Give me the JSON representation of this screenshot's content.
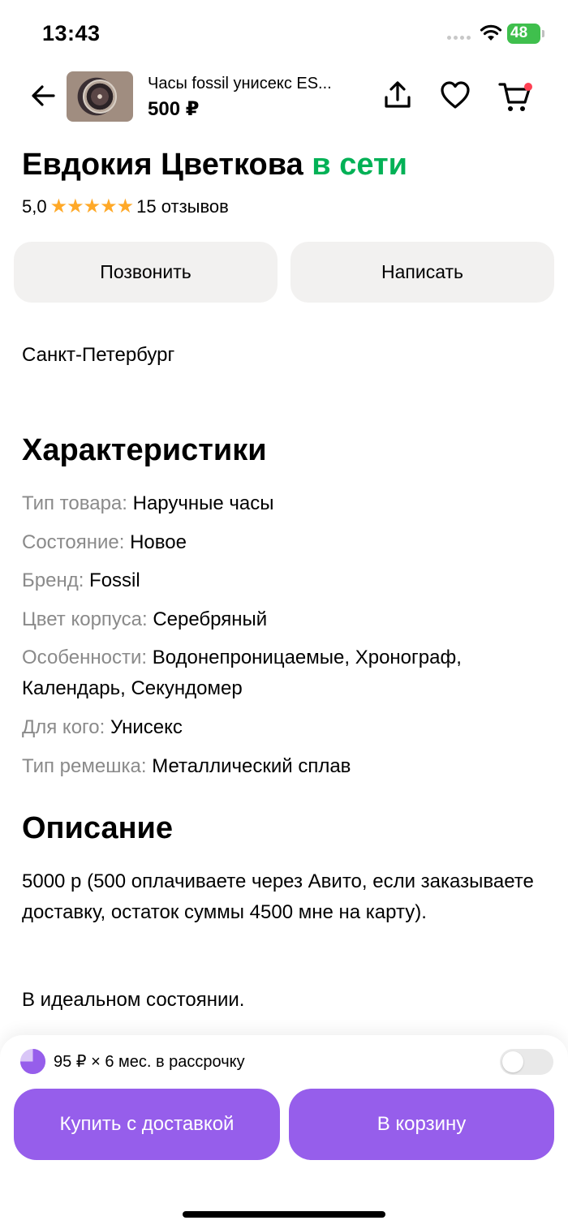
{
  "status_bar": {
    "time": "13:43",
    "battery": "48"
  },
  "header": {
    "title": "Часы fossil унисекс ES...",
    "price": "500 ₽"
  },
  "seller": {
    "name": "Евдокия Цветкова",
    "status": "в сети",
    "rating": "5,0",
    "stars": "★★★★★",
    "reviews": "15 отзывов"
  },
  "actions": {
    "call": "Позвонить",
    "write": "Написать"
  },
  "city": "Санкт-Петербург",
  "characteristics": {
    "title": "Характеристики",
    "rows": [
      {
        "key": "Тип товара:",
        "value": "Наручные часы"
      },
      {
        "key": "Состояние:",
        "value": "Новое"
      },
      {
        "key": "Бренд:",
        "value": "Fossil"
      },
      {
        "key": "Цвет корпуса:",
        "value": "Серебряный"
      },
      {
        "key": "Особенности:",
        "value": "Водонепроницаемые, Хронограф, Календарь, Секундомер"
      },
      {
        "key": "Для кого:",
        "value": "Унисекс"
      },
      {
        "key": "Тип ремешка:",
        "value": "Металлический сплав"
      }
    ]
  },
  "description": {
    "title": "Описание",
    "text": "5000 р (500 оплачиваете через Авито, если заказываете доставку, остаток суммы 4500 мне на карту).",
    "text2": "В идеальном состоянии."
  },
  "bottom": {
    "installment": "95 ₽ × 6 мес. в рассрочку",
    "buy_label": "Купить с доставкой",
    "cart_label": "В корзину"
  },
  "colors": {
    "accent": "#965eeb",
    "online": "#02b156",
    "star": "#ffa928",
    "cart_dot": "#ff4053"
  }
}
